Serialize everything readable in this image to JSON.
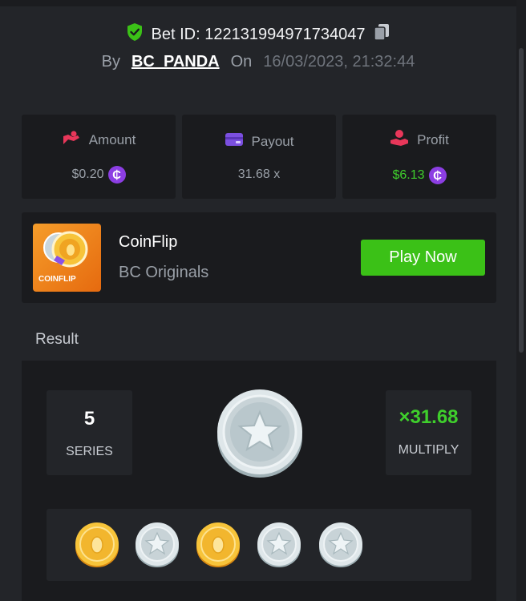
{
  "bet": {
    "id_text": "Bet ID: 122131994971734047",
    "by_label": "By",
    "user": "BC_PANDA",
    "on_label": "On",
    "datetime": "16/03/2023, 21:32:44"
  },
  "stats": [
    {
      "label": "Amount",
      "value": "$0.20",
      "icon": "amount-icon"
    },
    {
      "label": "Payout",
      "value": "31.68 x",
      "icon": "payout-icon"
    },
    {
      "label": "Profit",
      "value": "$6.13",
      "icon": "profit-icon"
    }
  ],
  "currency_symbol": "₵",
  "game": {
    "name": "CoinFlip",
    "provider": "BC Originals",
    "thumb_text": "COINFLIP",
    "play_label": "Play Now"
  },
  "result": {
    "label": "Result",
    "series_value": "5",
    "series_label": "SERIES",
    "multiplier_value": "×31.68",
    "multiplier_label": "MULTIPLY",
    "history": [
      "gold",
      "silver",
      "gold",
      "silver",
      "silver"
    ]
  },
  "colors": {
    "accent_green": "#3bc117",
    "profit_green": "#3fcf2c",
    "currency_purple": "#8c3ee3",
    "gold_coin": "#f2b62e",
    "silver_coin": "#c9d3d6"
  }
}
